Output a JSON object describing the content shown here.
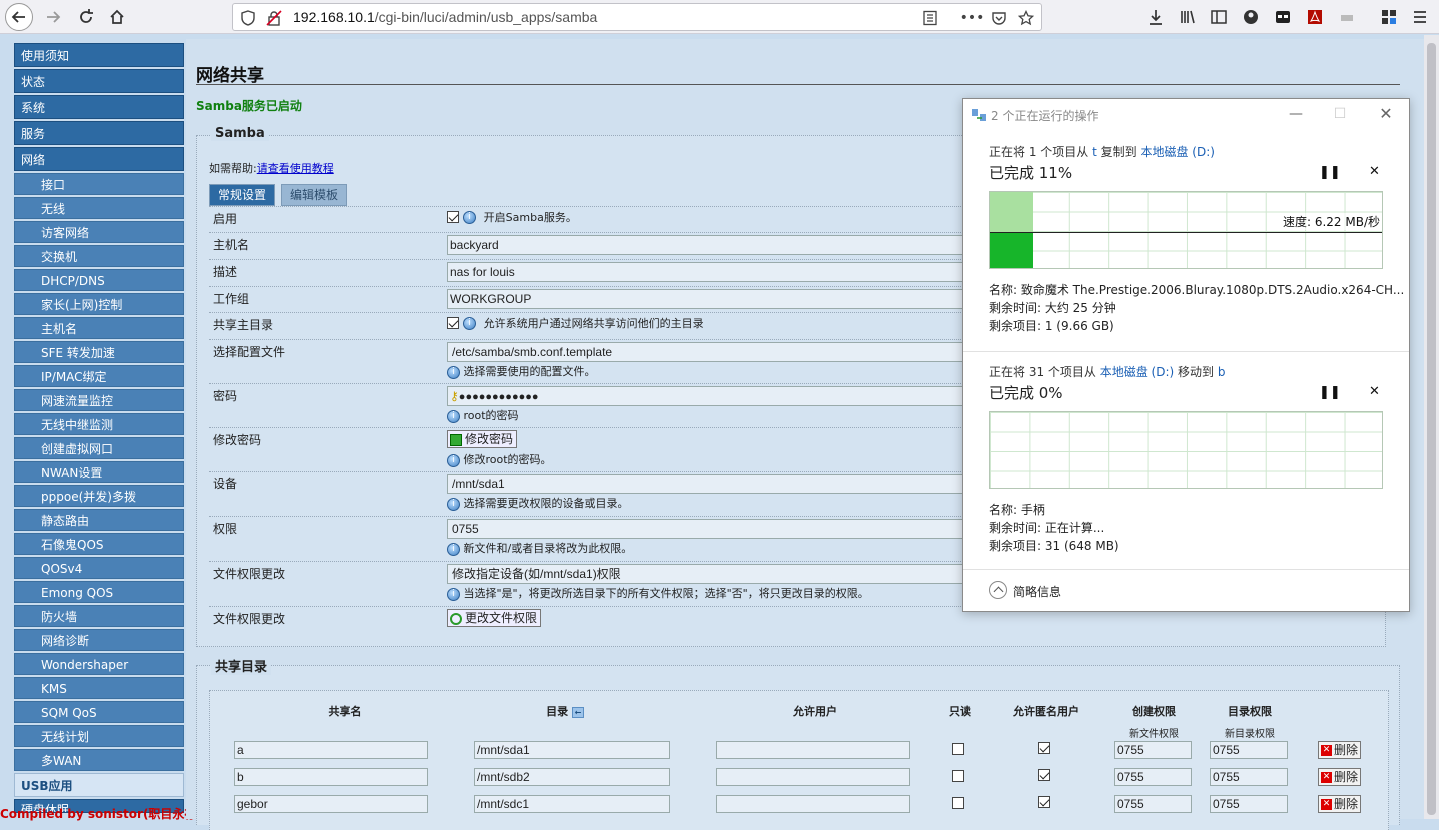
{
  "browser": {
    "url_host": "192.168.10.1",
    "url_path": "/cgi-bin/luci/admin/usb_apps/samba"
  },
  "sidebar": {
    "top_items": [
      "使用须知",
      "状态",
      "系统",
      "服务",
      "网络"
    ],
    "sub_items": [
      "接口",
      "无线",
      "访客网络",
      "交换机",
      "DHCP/DNS",
      "家长(上网)控制",
      "主机名",
      "SFE 转发加速",
      "IP/MAC绑定",
      "网速流量监控",
      "无线中继监测",
      "创建虚拟网口",
      "NWAN设置",
      "pppoe(并发)多拨",
      "静态路由",
      "石像鬼QOS",
      "QOSv4",
      "Emong QOS",
      "防火墙",
      "网络诊断",
      "Wondershaper",
      "KMS",
      "SQM QoS",
      "无线计划",
      "多WAN"
    ],
    "active_item": "USB应用",
    "next_item": "硬盘休眠",
    "corner_text": "Compiled by sonistor(职目永存)"
  },
  "main": {
    "title": "网络共享",
    "status": "Samba服务已启动",
    "samba": {
      "legend": "Samba",
      "help_prefix": "如需帮助:",
      "help_link": "请查看使用教程",
      "tabs": [
        "常规设置",
        "编辑模板"
      ],
      "rows": [
        {
          "label": "启用",
          "hint": "开启Samba服务。"
        },
        {
          "label": "主机名",
          "value": "backyard"
        },
        {
          "label": "描述",
          "value": "nas for louis"
        },
        {
          "label": "工作组",
          "value": "WORKGROUP"
        },
        {
          "label": "共享主目录",
          "hint": "允许系统用户通过网络共享访问他们的主目录"
        },
        {
          "label": "选择配置文件",
          "value": "/etc/samba/smb.conf.template",
          "sub": "选择需要使用的配置文件。"
        },
        {
          "label": "密码",
          "value": "●●●●●●●●●●●●",
          "sub": "root的密码"
        },
        {
          "label": "修改密码",
          "button": "修改密码",
          "sub": "修改root的密码。"
        },
        {
          "label": "设备",
          "value": "/mnt/sda1",
          "sub": "选择需要更改权限的设备或目录。"
        },
        {
          "label": "权限",
          "value": "0755",
          "sub": "新文件和/或者目录将改为此权限。"
        },
        {
          "label": "文件权限更改",
          "value": "修改指定设备(如/mnt/sda1)权限",
          "sub": "当选择\"是\"，将更改所选目录下的所有文件权限；选择\"否\"，将只更改目录的权限。"
        },
        {
          "label": "文件权限更改",
          "button": "更改文件权限"
        }
      ]
    },
    "shares": {
      "legend": "共享目录",
      "headers": [
        "共享名",
        "目录",
        "允许用户",
        "只读",
        "允许匿名用户",
        "创建权限",
        "目录权限"
      ],
      "subheaders": [
        "新文件权限",
        "新目录权限"
      ],
      "delete_label": "删除",
      "rows": [
        {
          "name": "a",
          "path": "/mnt/sda1",
          "users": "",
          "readonly": false,
          "anon": true,
          "create": "0755",
          "dir": "0755"
        },
        {
          "name": "b",
          "path": "/mnt/sdb2",
          "users": "",
          "readonly": false,
          "anon": true,
          "create": "0755",
          "dir": "0755"
        },
        {
          "name": "gebor",
          "path": "/mnt/sdc1",
          "users": "",
          "readonly": false,
          "anon": true,
          "create": "0755",
          "dir": "0755"
        }
      ]
    }
  },
  "dialog": {
    "title": "2 个正在运行的操作",
    "ops": [
      {
        "line_a": "正在将 1 个项目从 ",
        "src": "t",
        "line_b": " 复制到 ",
        "dst": "本地磁盘 (D:)",
        "percent_text": "已完成 11%",
        "progress": 0.11,
        "speed": "速度: 6.22 MB/秒",
        "name": "名称: 致命魔术 The.Prestige.2006.Bluray.1080p.DTS.2Audio.x264-CH...",
        "time": "剩余时间: 大约 25 分钟",
        "items": "剩余项目: 1 (9.66 GB)"
      },
      {
        "line_a": "正在将 31 个项目从 ",
        "src": "本地磁盘 (D:)",
        "line_b": " 移动到 ",
        "dst": "b",
        "percent_text": "已完成 0%",
        "progress": 0,
        "name": "名称: 手柄",
        "time": "剩余时间: 正在计算...",
        "items": "剩余项目: 31 (648 MB)"
      }
    ],
    "footer": "简略信息"
  }
}
